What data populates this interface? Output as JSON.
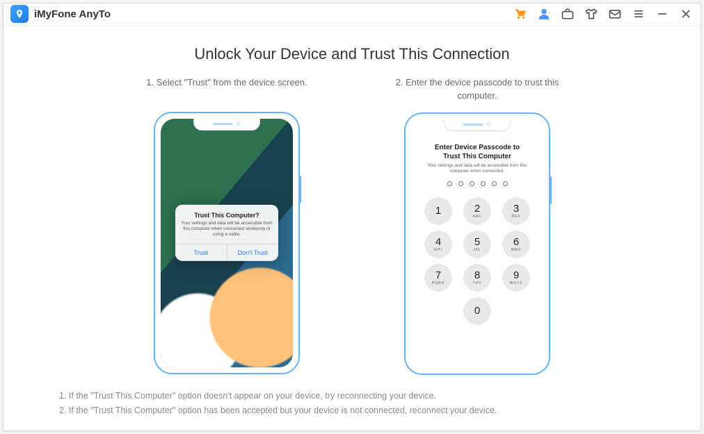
{
  "app": {
    "title": "iMyFone AnyTo"
  },
  "main": {
    "heading": "Unlock Your Device and Trust This Connection",
    "step1": {
      "caption": "1. Select \"Trust\" from the device screen.",
      "alert": {
        "title": "Trust This Computer?",
        "message": "Your settings and data will be accessible from this computer when connected wirelessly or using a cable.",
        "trust": "Trust",
        "dont_trust": "Don't Trust"
      }
    },
    "step2": {
      "caption": "2. Enter the device passcode to trust this computer.",
      "passcode": {
        "title": "Enter Device Passcode to Trust This Computer",
        "subtitle": "Your settings and data will be accessible from this computer when connected."
      },
      "keys": [
        {
          "n": "1",
          "l": ""
        },
        {
          "n": "2",
          "l": "ABC"
        },
        {
          "n": "3",
          "l": "DEF"
        },
        {
          "n": "4",
          "l": "GHI"
        },
        {
          "n": "5",
          "l": "JKL"
        },
        {
          "n": "6",
          "l": "MNO"
        },
        {
          "n": "7",
          "l": "PQRS"
        },
        {
          "n": "8",
          "l": "TUV"
        },
        {
          "n": "9",
          "l": "WXYZ"
        },
        {
          "n": "0",
          "l": ""
        }
      ]
    },
    "notes": {
      "n1": "1. If the \"Trust This Computer\" option doesn't appear on your device, try reconnecting your device.",
      "n2": "2. If the \"Trust This Computer\" option has been accepted but your device is not connected, reconnect your device."
    }
  }
}
